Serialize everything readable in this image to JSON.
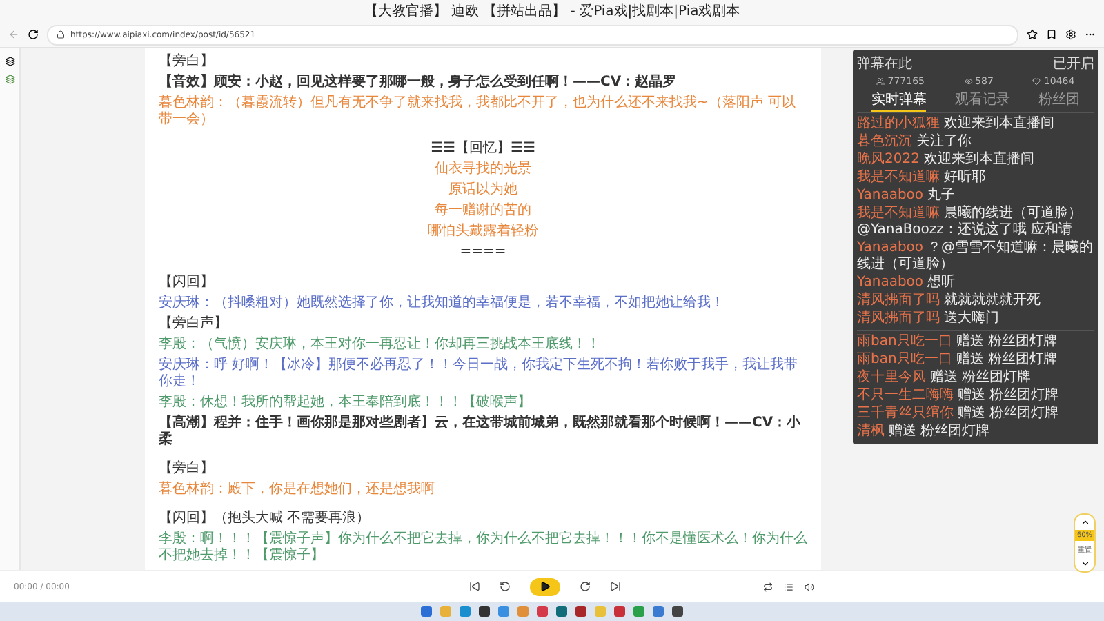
{
  "window": {
    "title": "【大教官播】 迪欧 【拼站出品】 - 爱Pia戏|找剧本|Pia戏剧本"
  },
  "address_bar": {
    "url": "https://www.aipiaxi.com/index/post/id/56521"
  },
  "script": [
    {
      "kind": "heading",
      "text": "【旁白】"
    },
    {
      "kind": "bold",
      "text": "【音效】顾安：小赵，回见这样要了那哪一般，身子怎么受到任啊！——CV：赵晶罗"
    },
    {
      "kind": "line",
      "color": "#e8863a",
      "text": "暮色林韵：（暮霞流转）但凡有无不争了就来找我，我都比不开了，也为什么还不来找我~（落阳声 可以带一会）"
    },
    {
      "kind": "gap"
    },
    {
      "kind": "center",
      "color": "#333333",
      "text": "☰☰【回忆】☰☰"
    },
    {
      "kind": "center",
      "color": "#e8863a",
      "text": "仙衣寻找的光景"
    },
    {
      "kind": "center",
      "color": "#e8863a",
      "text": "原话以为她"
    },
    {
      "kind": "center",
      "color": "#e8863a",
      "text": "每一赠谢的苦的"
    },
    {
      "kind": "center",
      "color": "#e8863a",
      "text": "哪怕头戴露着轻粉"
    },
    {
      "kind": "center",
      "color": "#333333",
      "text": "===="
    },
    {
      "kind": "gap"
    },
    {
      "kind": "heading",
      "text": "【闪回】"
    },
    {
      "kind": "line",
      "color": "#5b6fc9",
      "text": "安庆琳：（抖嗓粗对）她既然选择了你，让我知道的幸福便是，若不幸福，不如把她让给我！"
    },
    {
      "kind": "heading",
      "text": "【旁白声】"
    },
    {
      "kind": "line",
      "color": "#4e9a6a",
      "text": "李殷：（气愤）安庆琳，本王对你一再忍让！你却再三挑战本王底线！！"
    },
    {
      "kind": "line",
      "color": "#5b6fc9",
      "text": "安庆琳：呼 好啊！【冰冷】那便不必再忍了！！今日一战，你我定下生死不拘！若你败于我手，我让我带你走！"
    },
    {
      "kind": "line",
      "color": "#4e9a6a",
      "text": "李殷：休想！我所的帮起她，本王奉陪到底！！！【破喉声】"
    },
    {
      "kind": "bold",
      "text": "【高潮】程并：住手！画你那是那对些剧者】云，在这带城前城弟，既然那就看那个时候啊！——CV：小柔"
    },
    {
      "kind": "gap"
    },
    {
      "kind": "heading",
      "text": "【旁白】"
    },
    {
      "kind": "line",
      "color": "#e8863a",
      "text": "暮色林韵：殿下，你是在想她们，还是想我啊"
    },
    {
      "kind": "gap"
    },
    {
      "kind": "heading",
      "text": "【闪回】（抱头大喊 不需要再浪）"
    },
    {
      "kind": "line",
      "color": "#4e9a6a",
      "text": "李殷：啊！！！【震惊子声】你为什么不把它去掉，你为什么不把它去掉！！！你不是懂医术么！你为什么不把她去掉！！【震惊子】"
    }
  ],
  "chat": {
    "title": "弹幕在此",
    "status": "已开启",
    "stats": [
      "777165",
      "587",
      "10464"
    ],
    "tabs": [
      {
        "label": "实时弹幕",
        "selected": true
      },
      {
        "label": "观看记录",
        "selected": false
      },
      {
        "label": "粉丝团",
        "selected": false
      }
    ],
    "messages": [
      {
        "user": "路过的小狐狸",
        "text": "欢迎来到本直播间"
      },
      {
        "user": "暮色沉沉",
        "text": "关注了你"
      },
      {
        "user": "晚风2022",
        "text": "欢迎来到本直播间"
      },
      {
        "user": "我是不知道嘛",
        "text": "好听耶"
      },
      {
        "user": "Yanaaboo",
        "text": "丸子"
      },
      {
        "user": "我是不知道嘛",
        "text": "晨曦的线进（可道脸）@YanaBoozz：还说这了哦 应和请"
      },
      {
        "user": "Yanaaboo",
        "text": "？@雪雪不知道嘛：晨曦的线进（可道脸）"
      },
      {
        "user": "Yanaaboo",
        "text": "想听"
      },
      {
        "user": "清风拂面了吗",
        "text": "就就就就就开死"
      },
      {
        "user": "清风拂面了吗",
        "text": "送大嗨门"
      }
    ],
    "gifts": [
      {
        "user": "雨ban只吃一口",
        "text": "赠送 粉丝团灯牌"
      },
      {
        "user": "雨ban只吃一口",
        "text": "赠送 粉丝团灯牌"
      },
      {
        "user": "夜十里今风",
        "text": "赠送 粉丝团灯牌"
      },
      {
        "user": "不只一生二嗨嗨",
        "text": "赠送 粉丝团灯牌"
      },
      {
        "user": "三千青丝只绾你",
        "text": "赠送 粉丝团灯牌"
      },
      {
        "user": "清枫",
        "text": "赠送 粉丝团灯牌"
      }
    ]
  },
  "side_widget": {
    "zoom": "60%",
    "reset": "重置"
  },
  "player": {
    "time": "00:00 / 00:00"
  }
}
